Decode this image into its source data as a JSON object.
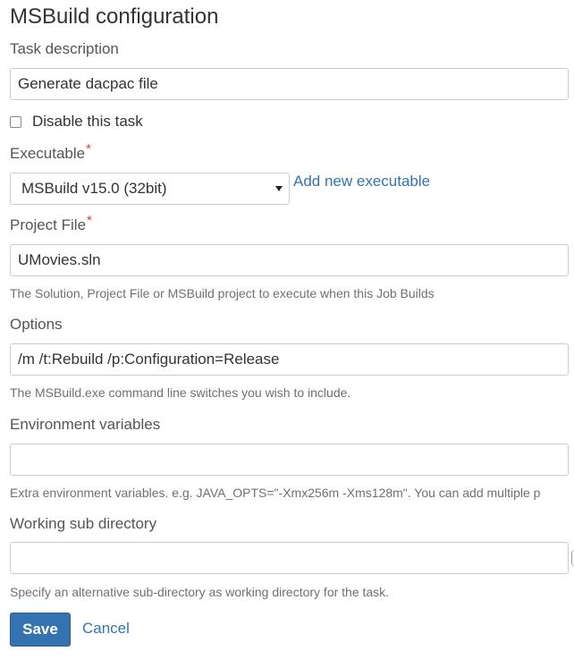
{
  "form": {
    "title": "MSBuild configuration",
    "task_description": {
      "label": "Task description",
      "value": "Generate dacpac file"
    },
    "disable_task": {
      "label": "Disable this task",
      "checked": false
    },
    "executable": {
      "label": "Executable",
      "required_marker": "*",
      "selected": "MSBuild v15.0 (32bit)",
      "add_link": "Add new executable"
    },
    "project_file": {
      "label": "Project File",
      "required_marker": "*",
      "value": "UMovies.sln",
      "help": "The Solution, Project File or MSBuild project to execute when this Job Builds"
    },
    "options": {
      "label": "Options",
      "value": "/m /t:Rebuild /p:Configuration=Release",
      "help": "The MSBuild.exe command line switches you wish to include."
    },
    "environment_variables": {
      "label": "Environment variables",
      "value": "",
      "help": "Extra environment variables. e.g. JAVA_OPTS=\"-Xmx256m -Xms128m\". You can add multiple p"
    },
    "working_sub_directory": {
      "label": "Working sub directory",
      "value": "",
      "help": "Specify an alternative sub-directory as working directory for the task."
    },
    "actions": {
      "save_label": "Save",
      "cancel_label": "Cancel"
    }
  },
  "colors": {
    "primary_button": "#3572b0",
    "link": "#3572b0",
    "required": "#d04437",
    "help_text": "#707070"
  },
  "icons": {
    "select_caret": "caret-down-icon",
    "checkbox": "checkbox-unchecked"
  }
}
